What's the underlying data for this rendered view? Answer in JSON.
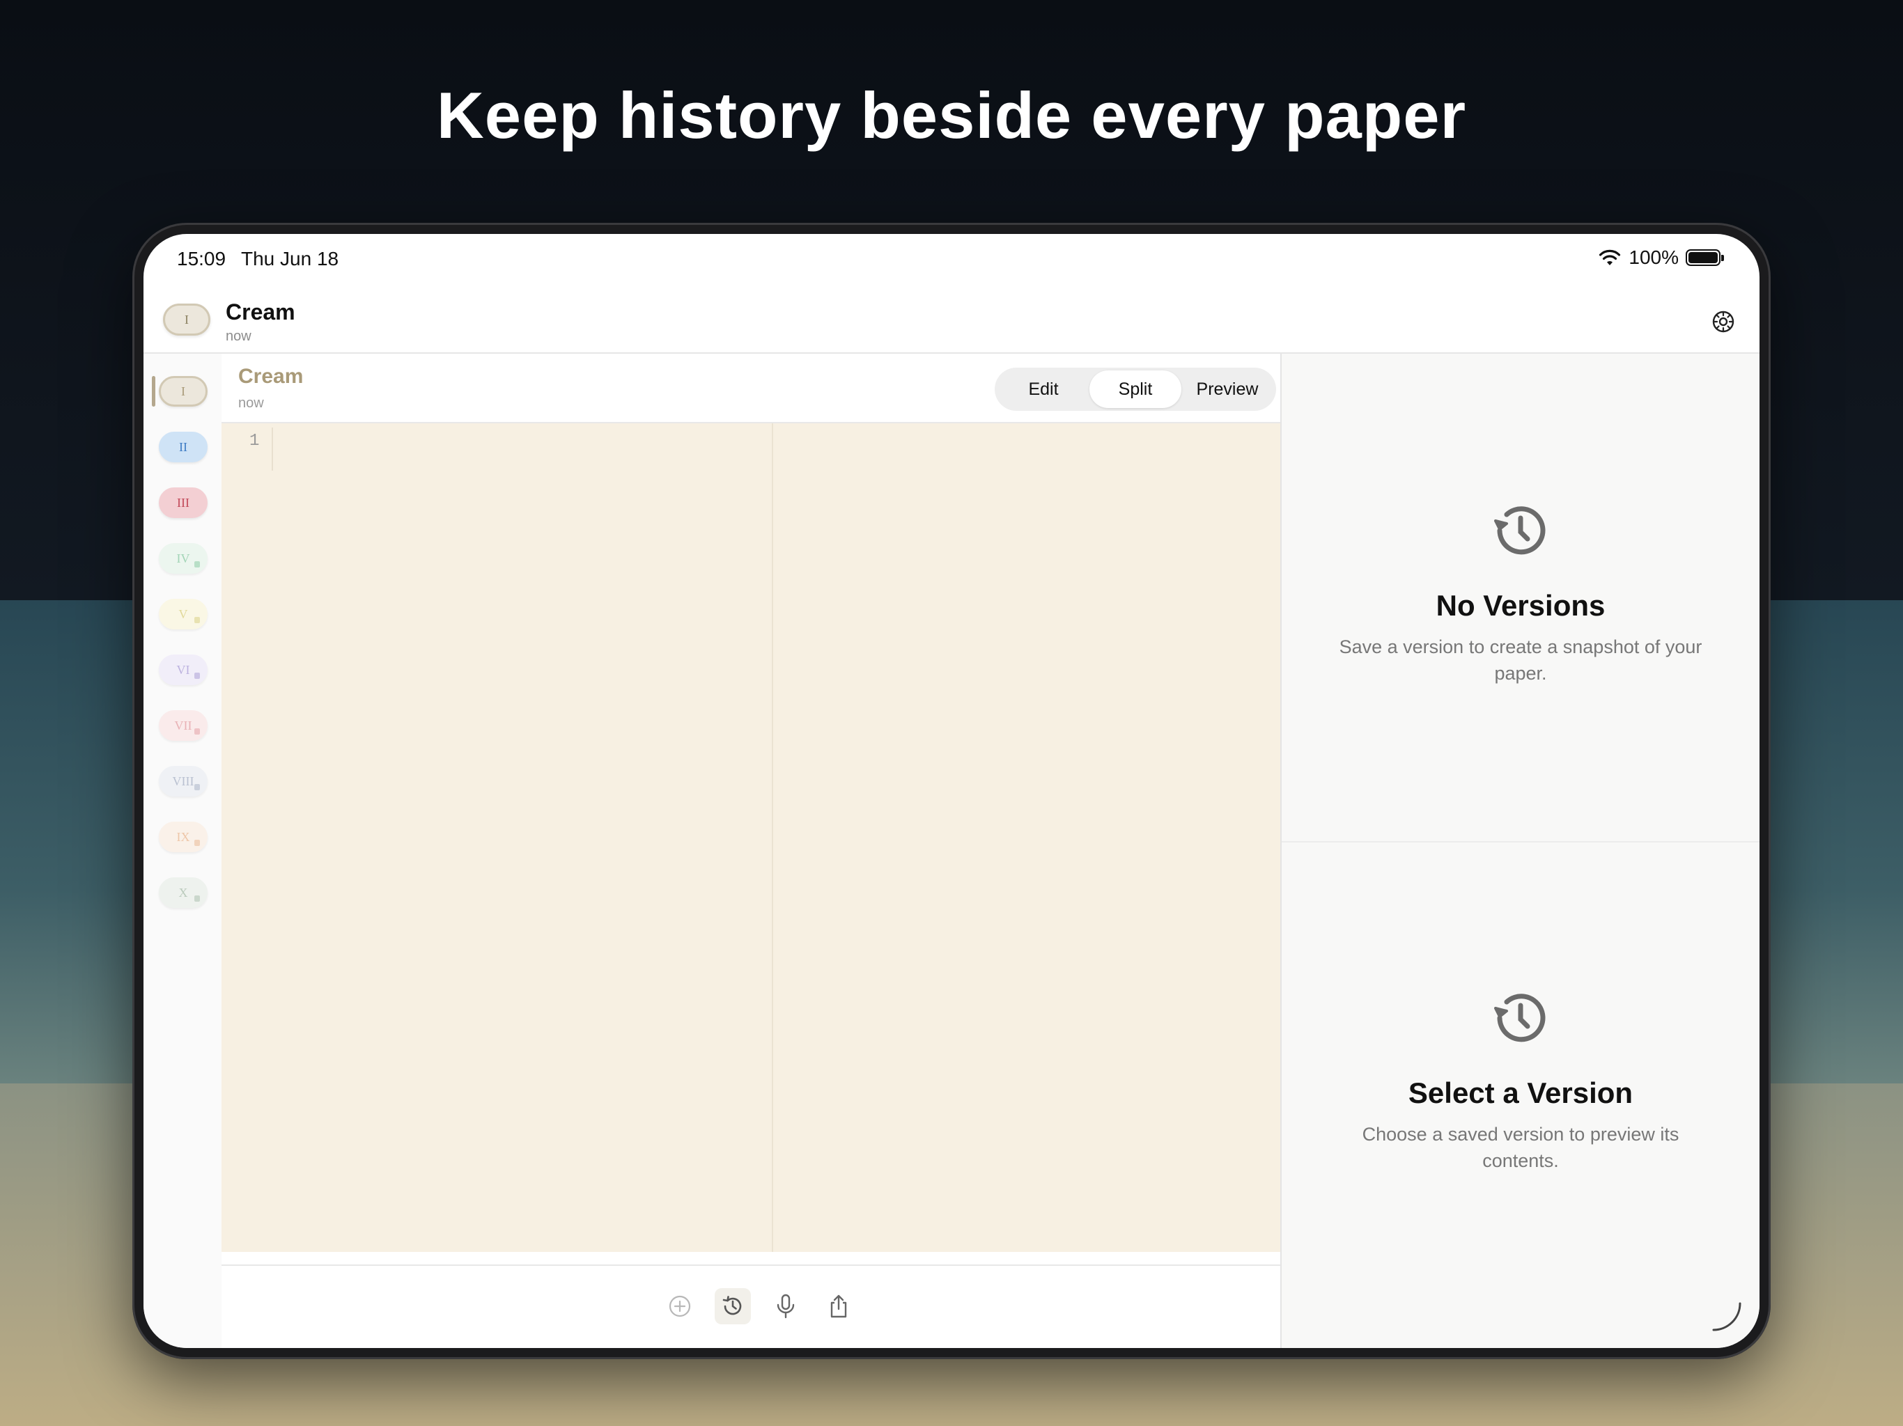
{
  "headline": "Keep history beside every paper",
  "status": {
    "time": "15:09",
    "date": "Thu Jun 18",
    "battery": "100%"
  },
  "topnav": {
    "pill_label": "I",
    "title": "Cream",
    "subtitle": "now"
  },
  "sidebar": {
    "items": [
      {
        "label": "I",
        "color": "#a99a78",
        "bg": "#ece7dc",
        "locked": false,
        "active": true
      },
      {
        "label": "II",
        "color": "#3d7cc4",
        "bg": "#cfe3f6",
        "locked": false,
        "active": false
      },
      {
        "label": "III",
        "color": "#c24a5a",
        "bg": "#f3cfd3",
        "locked": false,
        "active": false
      },
      {
        "label": "IV",
        "color": "#86c9a1",
        "bg": "#e8f5ec",
        "locked": true,
        "active": false
      },
      {
        "label": "V",
        "color": "#d9cf7a",
        "bg": "#fbf7df",
        "locked": true,
        "active": false
      },
      {
        "label": "VI",
        "color": "#a89ad6",
        "bg": "#efeaf9",
        "locked": true,
        "active": false
      },
      {
        "label": "VII",
        "color": "#e49aa0",
        "bg": "#fae7e7",
        "locked": true,
        "active": false
      },
      {
        "label": "VIII",
        "color": "#a5afc4",
        "bg": "#eceff4",
        "locked": true,
        "active": false
      },
      {
        "label": "IX",
        "color": "#eab68f",
        "bg": "#fbeee4",
        "locked": true,
        "active": false
      },
      {
        "label": "X",
        "color": "#a7bca9",
        "bg": "#eaf0ea",
        "locked": true,
        "active": false
      }
    ]
  },
  "editor": {
    "title": "Cream",
    "subtitle": "now",
    "modes": [
      "Edit",
      "Split",
      "Preview"
    ],
    "active_mode": "Split",
    "line_number": "1"
  },
  "toolbar": {
    "buttons": [
      "add-icon",
      "history-icon",
      "microphone-icon",
      "share-icon"
    ],
    "active": "history-icon"
  },
  "versions_panel": {
    "empty_title": "No Versions",
    "empty_desc": "Save a version to create a snapshot of your paper.",
    "select_title": "Select a Version",
    "select_desc": "Choose a saved version to preview its contents."
  },
  "colors": {
    "paper": "#f7f0e2",
    "accent": "#a99a78"
  }
}
